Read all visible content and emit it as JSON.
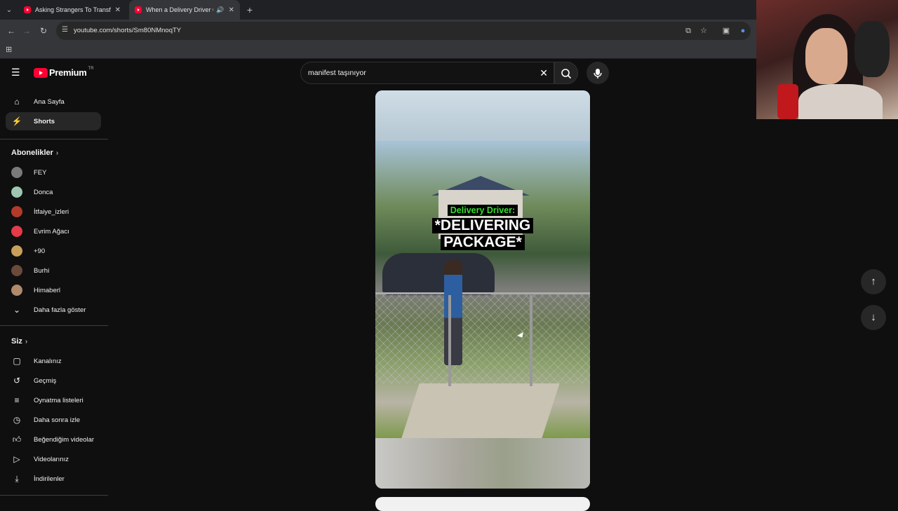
{
  "browser": {
    "tabs": [
      {
        "title": "Asking Strangers To Transform"
      },
      {
        "title": "When a Delivery Driver Out"
      }
    ],
    "url": "youtube.com/shorts/Sm80NMnoqTY"
  },
  "youtube": {
    "logo_text": "Premium",
    "country_code": "TR",
    "search_value": "manifest taşınıyor"
  },
  "sidebar": {
    "main": [
      {
        "label": "Ana Sayfa",
        "icon": "home-icon"
      },
      {
        "label": "Shorts",
        "icon": "shorts-icon"
      }
    ],
    "subscriptions_title": "Abonelikler",
    "subscriptions": [
      {
        "label": "FEY",
        "color": "#7a7a7a"
      },
      {
        "label": "Donca",
        "color": "#9ec6b0"
      },
      {
        "label": "İtfaiye_izleri",
        "color": "#b33a2a"
      },
      {
        "label": "Evrim Ağacı",
        "color": "#e43a4a"
      },
      {
        "label": "+90",
        "color": "#c9a05a"
      },
      {
        "label": "Burhi",
        "color": "#6a4a3a"
      },
      {
        "label": "Himaberl",
        "color": "#b08a6a"
      }
    ],
    "show_more": "Daha fazla göster",
    "you_title": "Siz",
    "you_items": [
      {
        "label": "Kanalınız",
        "icon": "channel-icon"
      },
      {
        "label": "Geçmiş",
        "icon": "history-icon"
      },
      {
        "label": "Oynatma listeleri",
        "icon": "playlist-icon"
      },
      {
        "label": "Daha sonra izle",
        "icon": "watch-later-icon"
      },
      {
        "label": "Beğendiğim videolar",
        "icon": "like-icon"
      },
      {
        "label": "Videolarınız",
        "icon": "your-videos-icon"
      },
      {
        "label": "İndirilenler",
        "icon": "download-icon"
      }
    ]
  },
  "short": {
    "caption_top": "Delivery Driver:",
    "caption_main_1": "*DELIVERING",
    "caption_main_2": "PACKAGE*"
  },
  "colors": {
    "brand_red": "#ff0033",
    "caption_green": "#33e02a"
  }
}
